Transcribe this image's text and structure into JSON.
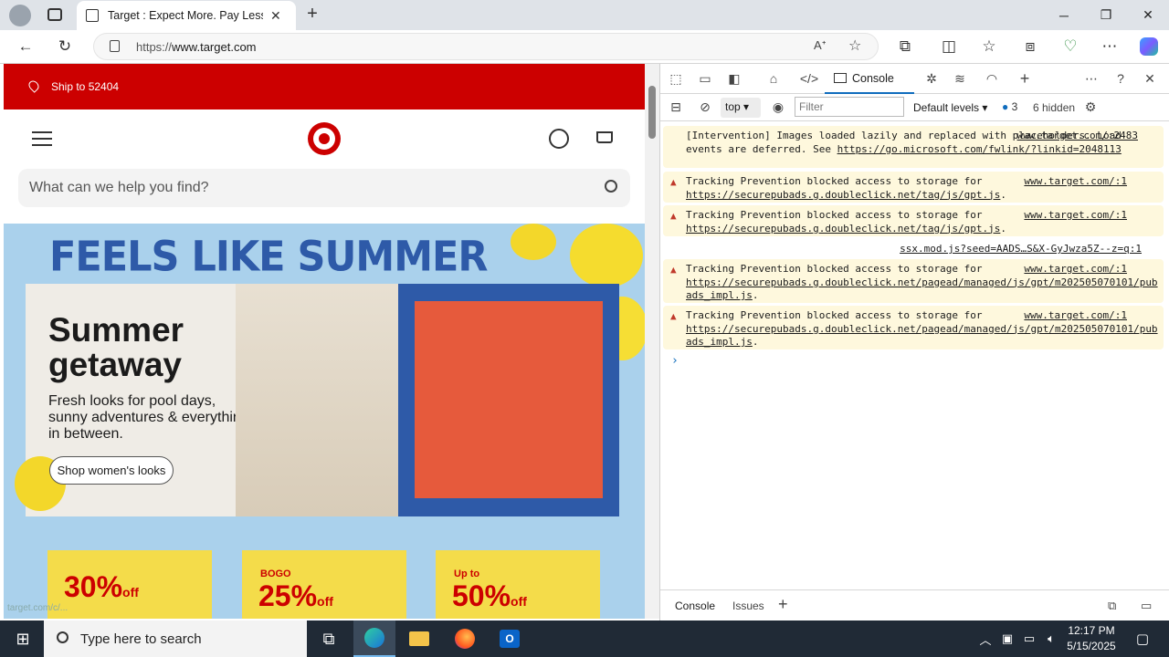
{
  "browser": {
    "tab_title": "Target : Expect More. Pay Less.",
    "url_scheme": "https://",
    "url_host": "www.target.com"
  },
  "page": {
    "ship_to": "Ship to 52404",
    "search_placeholder": "What can we help you find?",
    "hero_title": "FEELS LIKE SUMMER",
    "card_heading_line1": "Summer",
    "card_heading_line2": "getaway",
    "card_text": "Fresh looks for pool days, sunny adventures & everything in between.",
    "shop_button": "Shop women's looks",
    "status_url": "target.com/c/...",
    "promos": [
      {
        "small": "",
        "big": "30%",
        "suffix": "off"
      },
      {
        "small": "BOGO",
        "big": "25%",
        "suffix": "off"
      },
      {
        "small": "Up to",
        "big": "50%",
        "suffix": "off"
      }
    ]
  },
  "devtools": {
    "console_tab": "Console",
    "context": "top",
    "filter_placeholder": "Filter",
    "levels": "Default levels",
    "issues_count": "3",
    "hidden": "6 hidden",
    "bottom_tabs": [
      "Console",
      "Issues"
    ],
    "messages": [
      {
        "text": "[Intervention] Images loaded lazily and replaced with placeholders. Load events are deferred. See ",
        "link": "https://go.microsoft.com/fwlink/?linkid=2048113",
        "source": "www.target.com/:2483"
      },
      {
        "text": "Tracking Prevention blocked access to storage for ",
        "link": "https://securepubads.g.doubleclick.net/tag/js/gpt.js",
        "source": "www.target.com/:1"
      },
      {
        "text": "Tracking Prevention blocked access to storage for ",
        "link": "https://securepubads.g.doubleclick.net/tag/js/gpt.js",
        "source": "www.target.com/:1"
      },
      {
        "text": "",
        "link": "",
        "source": "ssx.mod.js?seed=AADS…S&X-GyJwza5Z--z=q:1"
      },
      {
        "text": "Tracking Prevention blocked access to storage for ",
        "link": "https://securepubads.g.doubleclick.net/pagead/managed/js/gpt/m202505070101/pubads_impl.js",
        "source": "www.target.com/:1"
      },
      {
        "text": "Tracking Prevention blocked access to storage for ",
        "link": "https://securepubads.g.doubleclick.net/pagead/managed/js/gpt/m202505070101/pubads_impl.js",
        "source": "www.target.com/:1"
      }
    ]
  },
  "taskbar": {
    "search_placeholder": "Type here to search",
    "time": "12:17 PM",
    "date": "5/15/2025"
  },
  "colors": {
    "target_red": "#cc0000",
    "hero_blue": "#aad1ec",
    "warning_bg": "#fef8dd",
    "devtools_accent": "#0f6cbd"
  }
}
